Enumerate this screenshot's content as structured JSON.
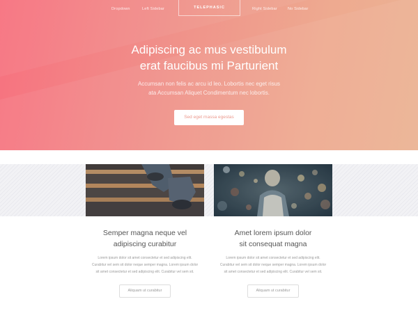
{
  "nav": {
    "items": [
      "Dropdown",
      "Left Sidebar",
      "Right Sidebar",
      "No Sidebar"
    ],
    "logo": "TELEPHASIC"
  },
  "hero": {
    "title_line1": "Adipiscing ac mus vestibulum",
    "title_line2": "erat faucibus mi Parturient",
    "text_line1": "Accumsan non felis ac arcu id leo. Lobortis nec eget risus",
    "text_line2": "ata Accumsan Aliquet Condimentum nec lobortis.",
    "cta_label": "Sed eget massa egestas"
  },
  "cards": [
    {
      "image": "stairs-feet-photo",
      "title_line1": "Semper magna neque vel",
      "title_line2": "adipiscing curabitur",
      "text_line1": "Lorem ipsum dolor sit amet consectetur et sed adipiscing elit.",
      "text_line2": "Curabitur vel sem sit dolor neque semper magna. Lorem ipsum dolor",
      "text_line3": "sit amet consectetur et sed adipiscing elit. Curabitur vel sem sit.",
      "button_label": "Aliquam ut curabitur"
    },
    {
      "image": "person-backpack-bokeh-photo",
      "title_line1": "Amet lorem ipsum dolor",
      "title_line2": "sit consequat magna",
      "text_line1": "Lorem ipsum dolor sit amet consectetur et sed adipiscing elit.",
      "text_line2": "Curabitur vel sem sit dolor neque semper magna. Lorem ipsum dolor",
      "text_line3": "sit amet consectetur et sed adipiscing elit. Curabitur vel sem sit.",
      "button_label": "Aliquam ut curabitur"
    }
  ],
  "colors": {
    "hero_start": "#f7717f",
    "hero_end": "#ebb393",
    "cta_text": "#eb9a8e"
  }
}
